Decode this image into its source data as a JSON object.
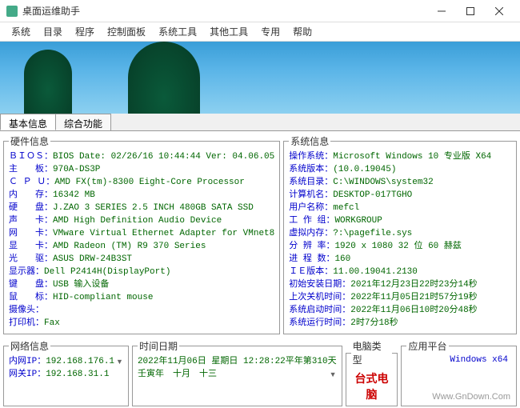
{
  "window": {
    "title": "桌面运维助手"
  },
  "menu": {
    "system": "系统",
    "catalog": "目录",
    "program": "程序",
    "control_panel": "控制面板",
    "system_tools": "系统工具",
    "other_tools": "其他工具",
    "special": "专用",
    "help": "帮助"
  },
  "tabs": {
    "basic": "基本信息",
    "comprehensive": "综合功能"
  },
  "hw": {
    "legend": "硬件信息",
    "bios_l": "ＢＩＯＳ：",
    "bios_v": "BIOS Date: 02/26/16 10:44:44 Ver: 04.06.05",
    "mb_l": "主　　板：",
    "mb_v": "970A-DS3P",
    "cpu_l": "Ｃ Ｐ Ｕ：",
    "cpu_v": "AMD FX(tm)-8300 Eight-Core Processor",
    "ram_l": "内　　存：",
    "ram_v": "16342 MB",
    "hdd_l": "硬　　盘：",
    "hdd_v": "J.ZAO 3 SERIES 2.5 INCH 480GB SATA SSD",
    "snd_l": "声　　卡：",
    "snd_v": "AMD High Definition Audio Device",
    "net_l": "网　　卡：",
    "net_v": "VMware Virtual Ethernet Adapter for VMnet8",
    "gpu_l": "显　　卡：",
    "gpu_v": "AMD Radeon (TM) R9 370 Series",
    "odd_l": "光　　驱：",
    "odd_v": "ASUS DRW-24B3ST",
    "mon_l": "显示器：",
    "mon_v": "Dell P2414H(DisplayPort)",
    "kb_l": "键　　盘：",
    "kb_v": "USB 输入设备",
    "ms_l": "鼠　　标：",
    "ms_v": "HID-compliant mouse",
    "cam_l": "摄像头：",
    "cam_v": "",
    "prn_l": "打印机：",
    "prn_v": "Fax"
  },
  "sys": {
    "legend": "系统信息",
    "os_l": "操作系统：",
    "os_v": "Microsoft Windows 10 专业版 X64",
    "ver_l": "系统版本：",
    "ver_v": " (10.0.19045)",
    "dir_l": "系统目录：",
    "dir_v": "C:\\WINDOWS\\system32",
    "host_l": "计算机名：",
    "host_v": "DESKTOP-017TGHO",
    "user_l": "用户名称：",
    "user_v": "mefcl",
    "wg_l": "工 作 组：",
    "wg_v": "WORKGROUP",
    "vmem_l": "虚拟内存：",
    "vmem_v": "?:\\pagefile.sys",
    "res_l": "分 辨 率：",
    "res_v": "1920 x 1080 32 位 60 赫兹",
    "proc_l": "进 程 数：",
    "proc_v": "160",
    "ie_l": "ＩＥ版本：",
    "ie_v": "11.00.19041.2130",
    "inst_l": "初始安装日期：",
    "inst_v": "2021年12月23日22时23分14秒",
    "shut_l": "上次关机时间：",
    "shut_v": "2022年11月05日21时57分19秒",
    "boot_l": "系统启动时间：",
    "boot_v": "2022年11月06日10时20分48秒",
    "up_l": "系统运行时间：",
    "up_v": "2时7分18秒"
  },
  "footer": {
    "net_legend": "网络信息",
    "innerip_l": "内网IP：",
    "innerip_v": "192.168.176.1",
    "outerip_l": "网关IP：",
    "outerip_v": "192.168.31.1",
    "dt_legend": "时间日期",
    "date_v": "2022年11月06日 星期日 12:28:22",
    "lunar_v": "壬寅年　十月　十三",
    "year_label": "平年",
    "day_label": "第310天",
    "type_legend": "电脑类型",
    "type_v": "台式电脑",
    "platform_legend": "应用平台",
    "platform_v": "Windows x64"
  },
  "watermark": "Www.GnDown.Com"
}
